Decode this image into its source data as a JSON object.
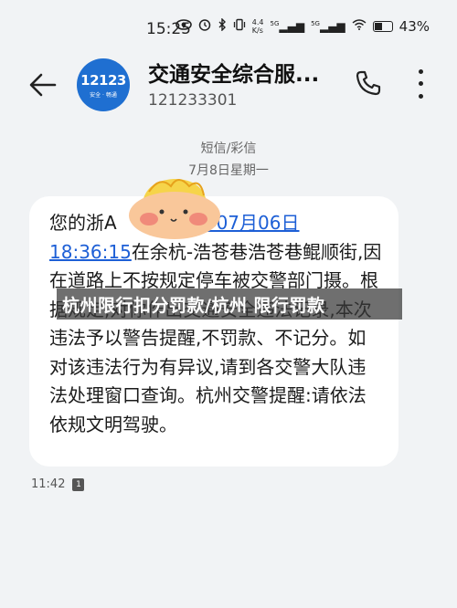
{
  "status": {
    "time": "15:25",
    "net_speed_value": "4.4",
    "net_speed_unit": "K/s",
    "sig1_label": "5G",
    "sig2_label": "5G",
    "battery_pct": "43%"
  },
  "header": {
    "avatar_main": "12123",
    "avatar_sub": "安全 · 畅通",
    "contact_name": "交通安全综合服...",
    "contact_number": "121233301"
  },
  "thread": {
    "category": "短信/彩信",
    "date": "7月8日星期一"
  },
  "message": {
    "part1": "您的浙A",
    "link_date": "2024年07月06日",
    "link_time": "18:36:15",
    "part2": "在余杭-浩苍巷浩苍巷鲲顺街,因在道路上不按规定停车被交警部门摄。根据规定,对你作出交通安全违法记录,本次违法予以警告提醒,不罚款、不记分。如对该违法行为有异议,请到各交警大队违法处理窗口查询。杭州交警提醒:请依法依规文明驾驶。",
    "time": "11:42",
    "sim": "1"
  },
  "banner_text": "杭州限行扣分罚款/杭州 限行罚款",
  "icons": [
    "back-arrow-icon",
    "phone-icon",
    "more-vertical-icon",
    "sticker-face-icon",
    "eye-icon",
    "alarm-icon",
    "bluetooth-icon",
    "vibrate-icon",
    "wifi-icon",
    "battery-icon"
  ]
}
